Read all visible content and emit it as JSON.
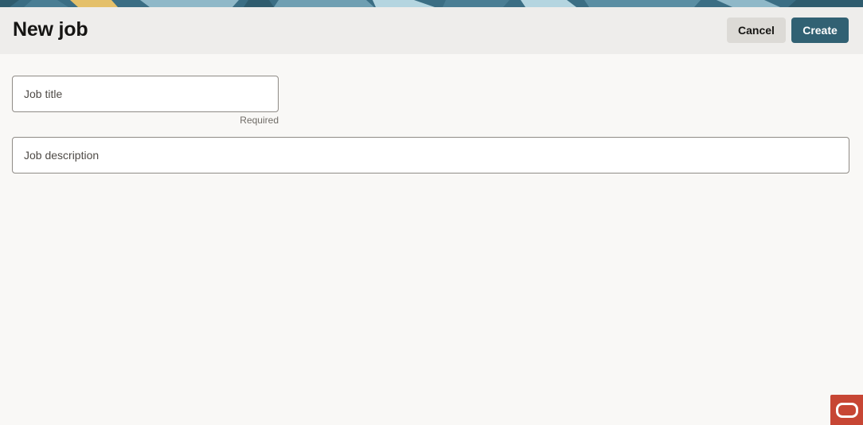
{
  "header": {
    "title": "New job",
    "cancel_label": "Cancel",
    "create_label": "Create"
  },
  "form": {
    "job_title": {
      "placeholder": "Job title",
      "value": "",
      "helper_text": "Required"
    },
    "job_description": {
      "placeholder": "Job description",
      "value": ""
    }
  },
  "branding": {
    "icon": "oracle-logo-icon",
    "badge_color": "#c74634"
  },
  "colors": {
    "primary_button": "#316173",
    "secondary_button": "#dcdad6",
    "banner_base": "#3b6e84",
    "banner_accent_gold": "#e4c06a",
    "banner_accent_light": "#b4d5e0"
  }
}
